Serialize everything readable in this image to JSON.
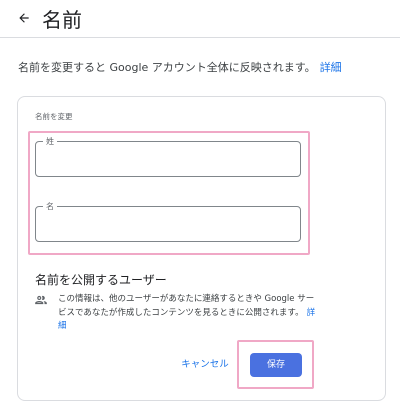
{
  "header": {
    "title": "名前",
    "back_icon": "arrow-back-icon"
  },
  "description": {
    "text": "名前を変更すると Google アカウント全体に反映されます。",
    "link_label": "詳細"
  },
  "form": {
    "section_label": "名前を変更",
    "last_name": {
      "label": "姓",
      "value": ""
    },
    "first_name": {
      "label": "名",
      "value": ""
    }
  },
  "visibility": {
    "title": "名前を公開するユーザー",
    "icon": "people-icon",
    "text": "この情報は、他のユーザーがあなたに連絡するときや Google サービスであなたが作成したコンテンツを見るときに公開されます。",
    "link_label": "詳細"
  },
  "actions": {
    "cancel_label": "キャンセル",
    "save_label": "保存"
  },
  "colors": {
    "accent": "#1a73e8",
    "save_button": "#4a71e0",
    "highlight": "#f0a8c6",
    "border": "#dadce0"
  }
}
